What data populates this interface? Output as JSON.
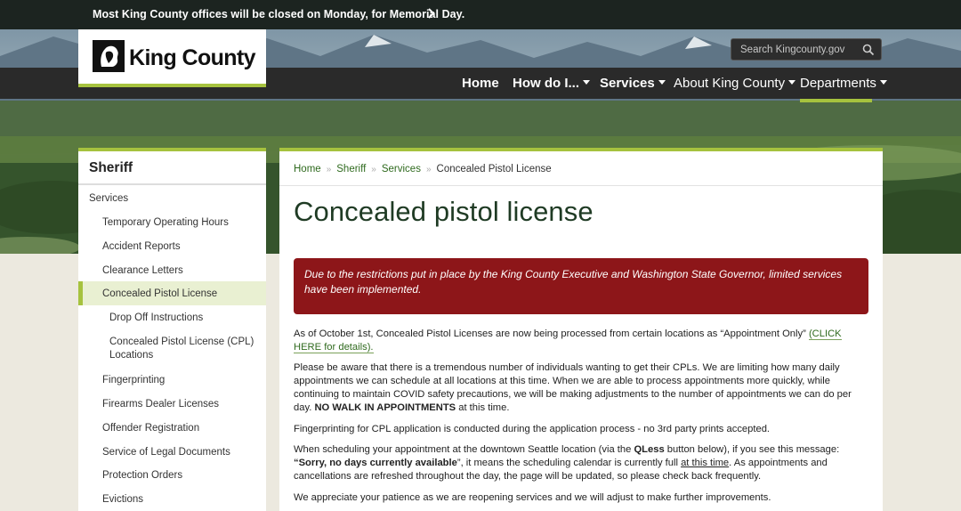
{
  "alert": {
    "text": "Most King County offices will be closed on Monday, for Memorial Day."
  },
  "logo": {
    "name": "King County"
  },
  "search": {
    "placeholder": "Search Kingcounty.gov"
  },
  "nav": {
    "home": "Home",
    "how_do_i": "How do I...",
    "services": "Services",
    "about": "About King County",
    "departments": "Departments"
  },
  "sidebar": {
    "title": "Sheriff",
    "items": [
      {
        "label": "Services"
      },
      {
        "label": "Temporary Operating Hours"
      },
      {
        "label": "Accident Reports"
      },
      {
        "label": "Clearance Letters"
      },
      {
        "label": "Concealed Pistol License"
      },
      {
        "label": "Drop Off Instructions"
      },
      {
        "label": "Concealed Pistol License (CPL) Locations"
      },
      {
        "label": "Fingerprinting"
      },
      {
        "label": "Firearms Dealer Licenses"
      },
      {
        "label": "Offender Registration"
      },
      {
        "label": "Service of Legal Documents"
      },
      {
        "label": "Protection Orders"
      },
      {
        "label": "Evictions"
      }
    ]
  },
  "breadcrumb": [
    "Home",
    "Sheriff",
    "Services",
    "Concealed Pistol License"
  ],
  "breadcrumb_sep": "»",
  "page": {
    "title": "Concealed pistol license",
    "notice": "Due to the restrictions put in place by the King County Executive and Washington State Governor, limited services have been implemented.",
    "p1": "As of October 1st, Concealed Pistol Licenses are now being processed from certain locations as “Appointment Only” ",
    "p1_link": "(CLICK HERE for details).",
    "p2": "Please be aware that there is a tremendous number of individuals wanting to get their CPLs.  We are limiting how many daily appointments we can schedule at all locations at this time. When we are able to process appointments more quickly, while continuing to maintain COVID safety precautions, we will be making adjustments to the number of appointments we can do per day.  ",
    "p2_bold": "NO WALK IN APPOINTMENTS",
    "p2_end": " at this time.",
    "p3": "Fingerprinting for CPL application is conducted during the application process - no 3rd party prints accepted.",
    "p4_a": "When scheduling your appointment at the downtown Seattle location (via the ",
    "p4_b": "QLess",
    "p4_c": " button below), if you see this message: ",
    "p4_d": "“Sorry, no days currently available",
    "p4_e": "”, it means the scheduling calendar is currently full ",
    "p4_f": "at this time",
    "p4_g": ". As appointments and cancellations are refreshed throughout the day, the page will be updated, so please check back frequently.",
    "p5": "We appreciate your patience as we are reopening services and we will adjust to make further improvements."
  },
  "colors": {
    "accent": "#a6c23e",
    "alert_red": "#8d1619",
    "link_green": "#2f6a1e",
    "dark_bar": "#1c2420"
  }
}
